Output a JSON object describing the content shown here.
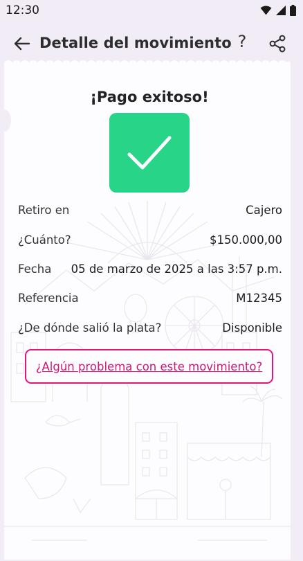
{
  "status_bar": {
    "time": "12:30"
  },
  "header": {
    "title": "Detalle del movimiento",
    "help_label": "?"
  },
  "receipt": {
    "title": "¡Pago exitoso!",
    "rows": [
      {
        "label": "Retiro en",
        "value": "Cajero"
      },
      {
        "label": "¿Cuánto?",
        "value": "$150.000,00"
      },
      {
        "label": "Fecha",
        "value": "05 de marzo de 2025 a las 3:57 p.m."
      },
      {
        "label": "Referencia",
        "value": "M12345"
      },
      {
        "label": "¿De dónde salió la plata?",
        "value": "Disponible"
      }
    ],
    "problem_button": "¿Algún problema con este movimiento?"
  },
  "colors": {
    "background": "#f1ecf6",
    "success_green": "#27d488",
    "accent_pink": "#e2157f"
  },
  "icons": [
    "back-arrow-icon",
    "help-icon",
    "share-icon",
    "check-icon",
    "wifi-icon",
    "signal-icon",
    "battery-icon"
  ]
}
